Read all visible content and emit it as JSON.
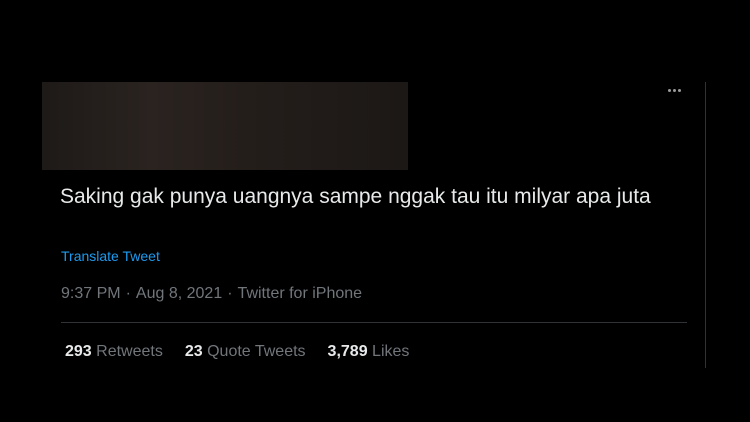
{
  "tweet": {
    "text": "Saking gak punya uangnya sampe nggak tau itu milyar apa juta",
    "translate_label": "Translate Tweet",
    "time": "9:37 PM",
    "date": "Aug 8, 2021",
    "source": "Twitter for iPhone",
    "separator": "·",
    "more_icon": "more-horizontal-icon"
  },
  "stats": {
    "retweets": {
      "count": "293",
      "label": "Retweets"
    },
    "quote_tweets": {
      "count": "23",
      "label": "Quote Tweets"
    },
    "likes": {
      "count": "3,789",
      "label": "Likes"
    }
  },
  "colors": {
    "background": "#000000",
    "text": "#e7e9ea",
    "secondary": "#71767b",
    "link": "#1d9bf0",
    "border": "#2f3336"
  }
}
